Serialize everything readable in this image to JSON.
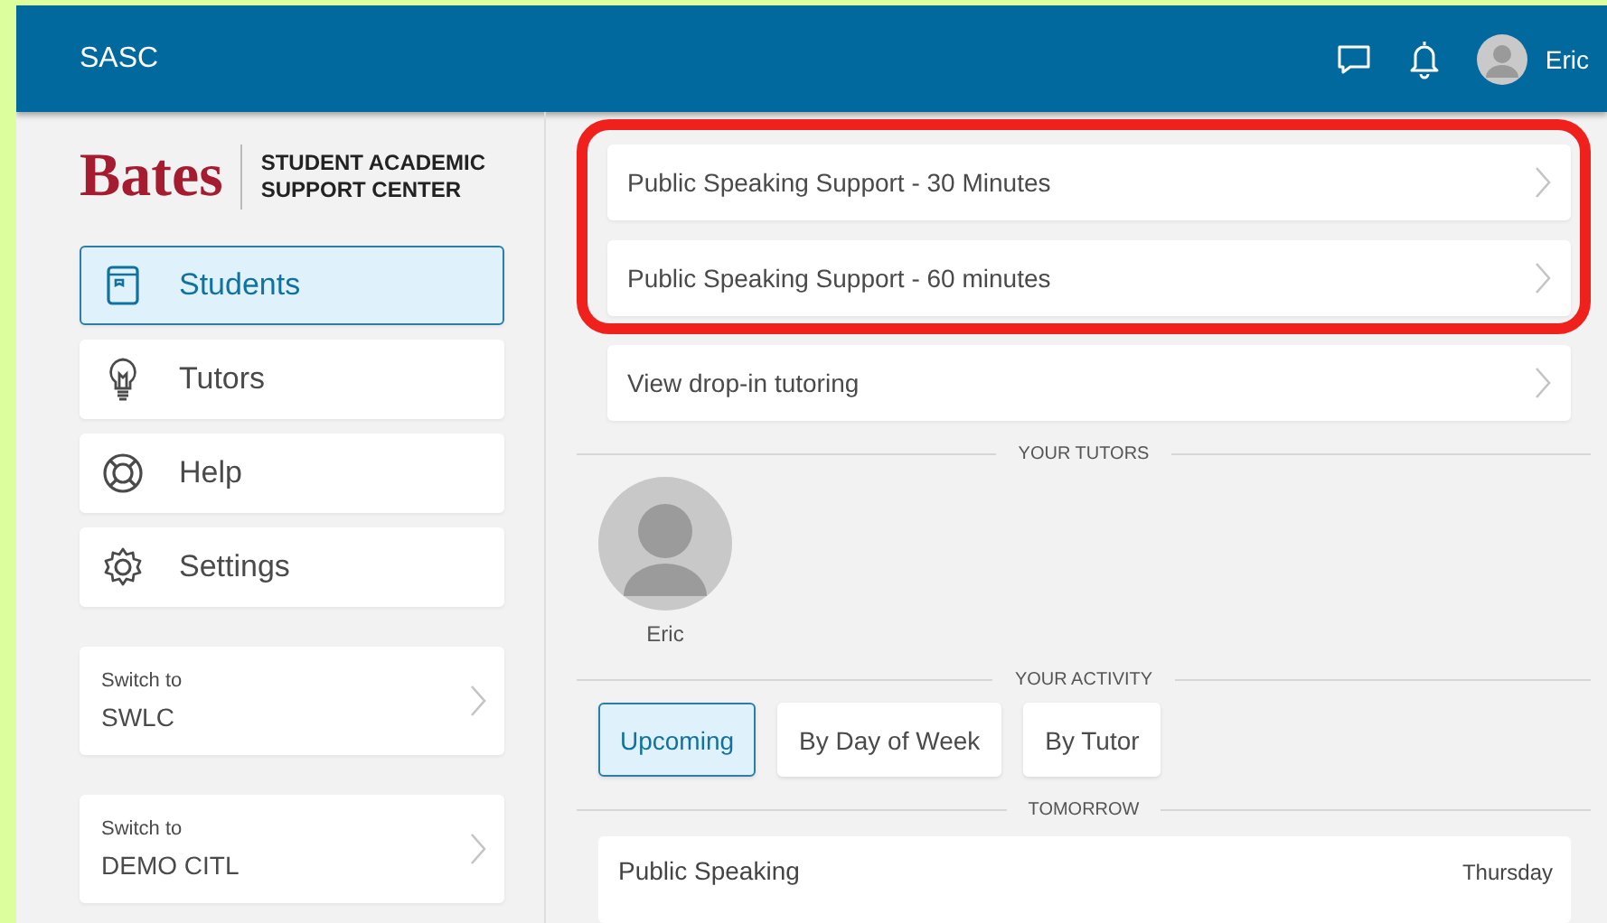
{
  "header": {
    "title": "SASC",
    "user_name": "Eric"
  },
  "sidebar": {
    "logo": {
      "wordmark": "Bates",
      "subtitle_line_1": "STUDENT ACADEMIC",
      "subtitle_line_2": "SUPPORT CENTER"
    },
    "nav_items": [
      {
        "label": "Students",
        "kind": "book",
        "selected": true
      },
      {
        "label": "Tutors",
        "kind": "bulb",
        "selected": false
      },
      {
        "label": "Help",
        "kind": "lifebuoy",
        "selected": false
      },
      {
        "label": "Settings",
        "kind": "gear",
        "selected": false
      }
    ],
    "switch_cards": [
      {
        "caption": "Switch to",
        "name": "SWLC"
      },
      {
        "caption": "Switch to",
        "name": "DEMO CITL"
      }
    ]
  },
  "main": {
    "highlighted_options": [
      {
        "label": "Public Speaking Support - 30 Minutes"
      },
      {
        "label": "Public Speaking Support - 60 minutes"
      }
    ],
    "other_options": [
      {
        "label": "View drop-in tutoring"
      }
    ],
    "tutors_heading": "YOUR TUTORS",
    "tutors": [
      {
        "name": "Eric"
      }
    ],
    "activity_heading": "YOUR ACTIVITY",
    "activity_tabs": [
      {
        "label": "Upcoming",
        "selected": true
      },
      {
        "label": "By Day of Week",
        "selected": false
      },
      {
        "label": "By Tutor",
        "selected": false
      }
    ],
    "day_heading": "TOMORROW",
    "sessions": [
      {
        "title": "Public Speaking",
        "day": "Thursday"
      }
    ]
  }
}
